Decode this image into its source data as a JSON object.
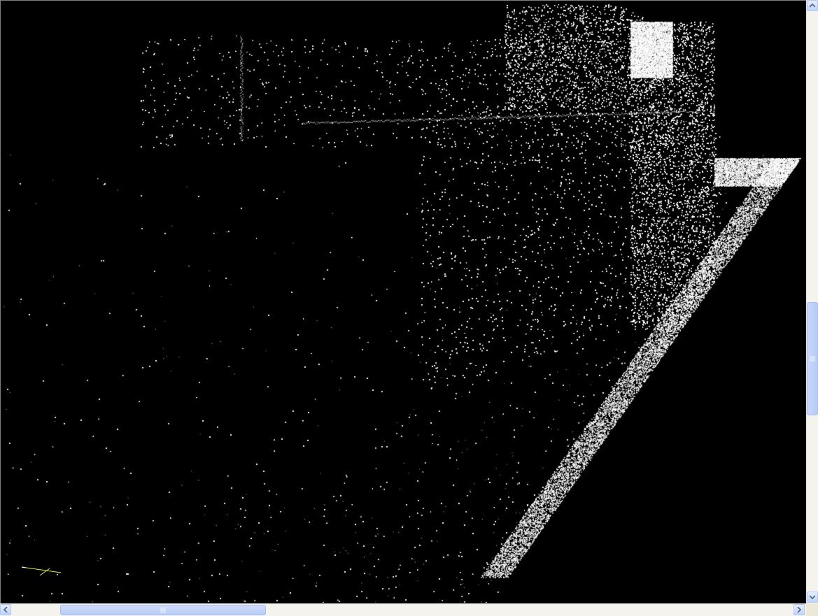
{
  "app": {
    "view": "point-cloud-3d-viewport"
  },
  "colors": {
    "background": "#000000",
    "points": "#ffffff",
    "axis": "#e8e83a",
    "scrollbar_track": "#f4f3ee",
    "scrollbar_thumb": "#c1d3fb"
  },
  "icons": {
    "scroll_up": "chevron-up-icon",
    "scroll_down": "chevron-down-icon",
    "scroll_left": "chevron-left-icon",
    "scroll_right": "chevron-right-icon",
    "axis": "axis-gizmo-icon"
  },
  "scrollbars": {
    "vertical_position": 0.5,
    "horizontal_position": 0.08
  }
}
